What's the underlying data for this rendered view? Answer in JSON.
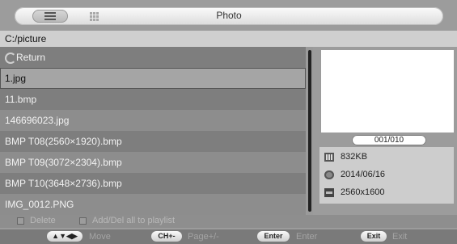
{
  "header": {
    "title": "Photo",
    "views": [
      {
        "icon": "list-view-icon"
      },
      {
        "icon": "grid-view-icon"
      }
    ]
  },
  "path": "C:/picture",
  "files": {
    "items": [
      {
        "label": "Return",
        "type": "return"
      },
      {
        "label": "1.jpg",
        "selected": true
      },
      {
        "label": "11.bmp"
      },
      {
        "label": "146696023.jpg"
      },
      {
        "label": "BMP  T08(2560×1920).bmp"
      },
      {
        "label": "BMP  T09(3072×2304).bmp"
      },
      {
        "label": "BMP  T10(3648×2736).bmp"
      },
      {
        "label": "IMG_0012.PNG"
      }
    ]
  },
  "preview": {
    "pager": "001/010",
    "info": {
      "size": "832KB",
      "date": "2014/06/16",
      "resolution": "2560x1600"
    }
  },
  "options": {
    "delete": "Delete",
    "add_del": "Add/Del  all to playlist"
  },
  "keys": [
    {
      "key": "▲▼◀▶",
      "label": "Move"
    },
    {
      "key": "CH+-",
      "label": "Page+/-"
    },
    {
      "key": "Enter",
      "label": "Enter"
    },
    {
      "key": "Exit",
      "label": "Exit"
    }
  ],
  "colors": {
    "background": "#9c9c9c",
    "row_dark": "#7e7e7e",
    "row_light": "#8d8d8d",
    "selected_row": "#a5a5a5"
  }
}
